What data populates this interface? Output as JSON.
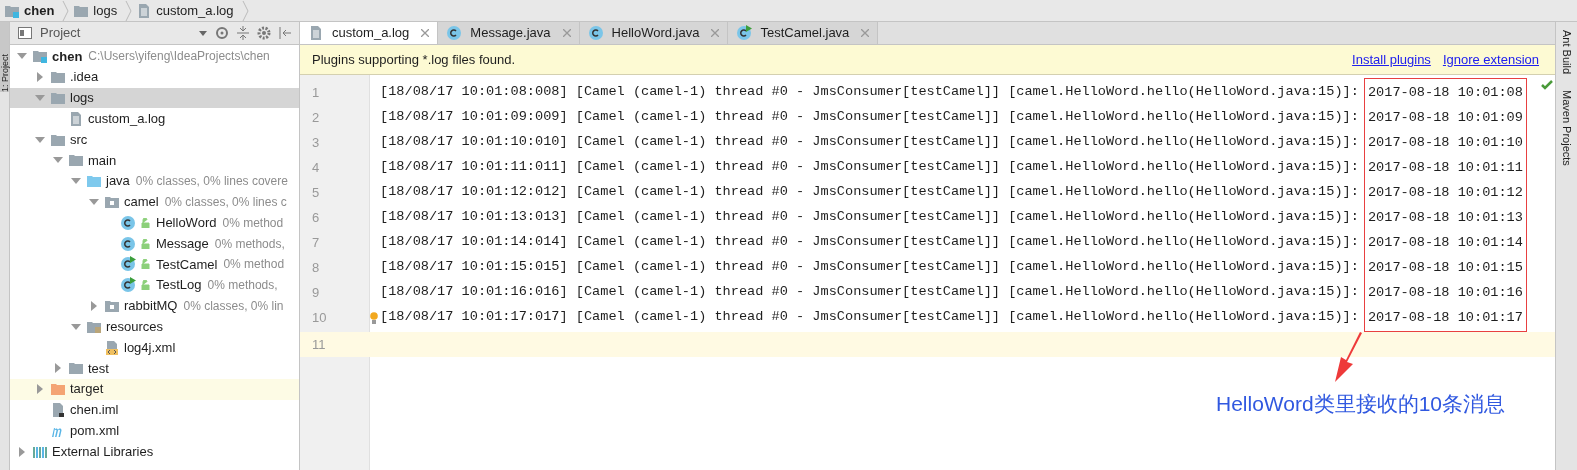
{
  "breadcrumb": [
    {
      "kind": "module",
      "label": "chen"
    },
    {
      "kind": "folder",
      "label": "logs"
    },
    {
      "kind": "log-file",
      "label": "custom_a.log"
    }
  ],
  "left_strip": {
    "label": "1: Project"
  },
  "project_panel": {
    "title": "Project",
    "tree": [
      {
        "kind": "module",
        "label": "chen",
        "hint": "C:\\Users\\yifeng\\IdeaProjects\\chen",
        "expanded": true,
        "selected": false,
        "children": [
          {
            "kind": "folder",
            "label": ".idea",
            "expanded": false,
            "selected": false
          },
          {
            "kind": "folder",
            "label": "logs",
            "expanded": true,
            "selected": true,
            "children": [
              {
                "kind": "log-file",
                "label": "custom_a.log",
                "selected": false
              }
            ]
          },
          {
            "kind": "folder",
            "label": "src",
            "expanded": true,
            "selected": false,
            "children": [
              {
                "kind": "folder",
                "label": "main",
                "expanded": true,
                "selected": false,
                "children": [
                  {
                    "kind": "source-folder",
                    "label": "java",
                    "hint": "0% classes, 0% lines covere",
                    "expanded": true,
                    "selected": false,
                    "children": [
                      {
                        "kind": "package",
                        "label": "camel",
                        "hint": "0% classes, 0% lines c",
                        "expanded": true,
                        "selected": false,
                        "children": [
                          {
                            "kind": "class",
                            "label": "HelloWord",
                            "hint": "0% method",
                            "selected": false
                          },
                          {
                            "kind": "class",
                            "label": "Message",
                            "hint": "0% methods,",
                            "selected": false
                          },
                          {
                            "kind": "test-class",
                            "label": "TestCamel",
                            "hint": "0% method",
                            "selected": false
                          },
                          {
                            "kind": "test-class",
                            "label": "TestLog",
                            "hint": "0% methods,",
                            "selected": false
                          }
                        ]
                      },
                      {
                        "kind": "package",
                        "label": "rabbitMQ",
                        "hint": "0% classes, 0% lin",
                        "expanded": false,
                        "selected": false
                      }
                    ]
                  },
                  {
                    "kind": "resources-folder",
                    "label": "resources",
                    "expanded": true,
                    "selected": false,
                    "children": [
                      {
                        "kind": "xml-file",
                        "label": "log4j.xml",
                        "selected": false
                      }
                    ]
                  }
                ]
              },
              {
                "kind": "folder",
                "label": "test",
                "expanded": false,
                "selected": false
              }
            ]
          },
          {
            "kind": "excluded-folder",
            "label": "target",
            "expanded": false,
            "selected": false,
            "highlighted": true
          },
          {
            "kind": "iml-file",
            "label": "chen.iml",
            "selected": false
          },
          {
            "kind": "maven-file",
            "label": "pom.xml",
            "selected": false
          }
        ]
      },
      {
        "kind": "libraries",
        "label": "External Libraries",
        "expanded": false,
        "selected": false
      }
    ]
  },
  "tabs": [
    {
      "kind": "log-file",
      "label": "custom_a.log",
      "selected": true
    },
    {
      "kind": "class",
      "label": "Message.java",
      "selected": false
    },
    {
      "kind": "class",
      "label": "HelloWord.java",
      "selected": false
    },
    {
      "kind": "test-class",
      "label": "TestCamel.java",
      "selected": false
    }
  ],
  "notification": {
    "text": "Plugins supporting *.log files found.",
    "links": [
      "Install plugins",
      "Ignore extension"
    ]
  },
  "editor": {
    "lines": [
      {
        "number": "1",
        "message": "[18/08/17 10:01:08:008] [Camel (camel-1) thread #0 - JmsConsumer[testCamel]] [camel.HelloWord.hello(HelloWord.java:15)]:",
        "timestamp": "2017-08-18 10:01:08"
      },
      {
        "number": "2",
        "message": "[18/08/17 10:01:09:009] [Camel (camel-1) thread #0 - JmsConsumer[testCamel]] [camel.HelloWord.hello(HelloWord.java:15)]:",
        "timestamp": "2017-08-18 10:01:09"
      },
      {
        "number": "3",
        "message": "[18/08/17 10:01:10:010] [Camel (camel-1) thread #0 - JmsConsumer[testCamel]] [camel.HelloWord.hello(HelloWord.java:15)]:",
        "timestamp": "2017-08-18 10:01:10"
      },
      {
        "number": "4",
        "message": "[18/08/17 10:01:11:011] [Camel (camel-1) thread #0 - JmsConsumer[testCamel]] [camel.HelloWord.hello(HelloWord.java:15)]:",
        "timestamp": "2017-08-18 10:01:11"
      },
      {
        "number": "5",
        "message": "[18/08/17 10:01:12:012] [Camel (camel-1) thread #0 - JmsConsumer[testCamel]] [camel.HelloWord.hello(HelloWord.java:15)]:",
        "timestamp": "2017-08-18 10:01:12"
      },
      {
        "number": "6",
        "message": "[18/08/17 10:01:13:013] [Camel (camel-1) thread #0 - JmsConsumer[testCamel]] [camel.HelloWord.hello(HelloWord.java:15)]:",
        "timestamp": "2017-08-18 10:01:13"
      },
      {
        "number": "7",
        "message": "[18/08/17 10:01:14:014] [Camel (camel-1) thread #0 - JmsConsumer[testCamel]] [camel.HelloWord.hello(HelloWord.java:15)]:",
        "timestamp": "2017-08-18 10:01:14"
      },
      {
        "number": "8",
        "message": "[18/08/17 10:01:15:015] [Camel (camel-1) thread #0 - JmsConsumer[testCamel]] [camel.HelloWord.hello(HelloWord.java:15)]:",
        "timestamp": "2017-08-18 10:01:15"
      },
      {
        "number": "9",
        "message": "[18/08/17 10:01:16:016] [Camel (camel-1) thread #0 - JmsConsumer[testCamel]] [camel.HelloWord.hello(HelloWord.java:15)]:",
        "timestamp": "2017-08-18 10:01:16"
      },
      {
        "number": "10",
        "message": "[18/08/17 10:01:17:017] [Camel (camel-1) thread #0 - JmsConsumer[testCamel]] [camel.HelloWord.hello(HelloWord.java:15)]:",
        "timestamp": "2017-08-18 10:01:17",
        "intention_bulb": true
      }
    ],
    "current_line": "11",
    "annotation": "HelloWord类里接收的10条消息"
  },
  "right_strip": [
    "Ant Build",
    "Maven Projects"
  ]
}
